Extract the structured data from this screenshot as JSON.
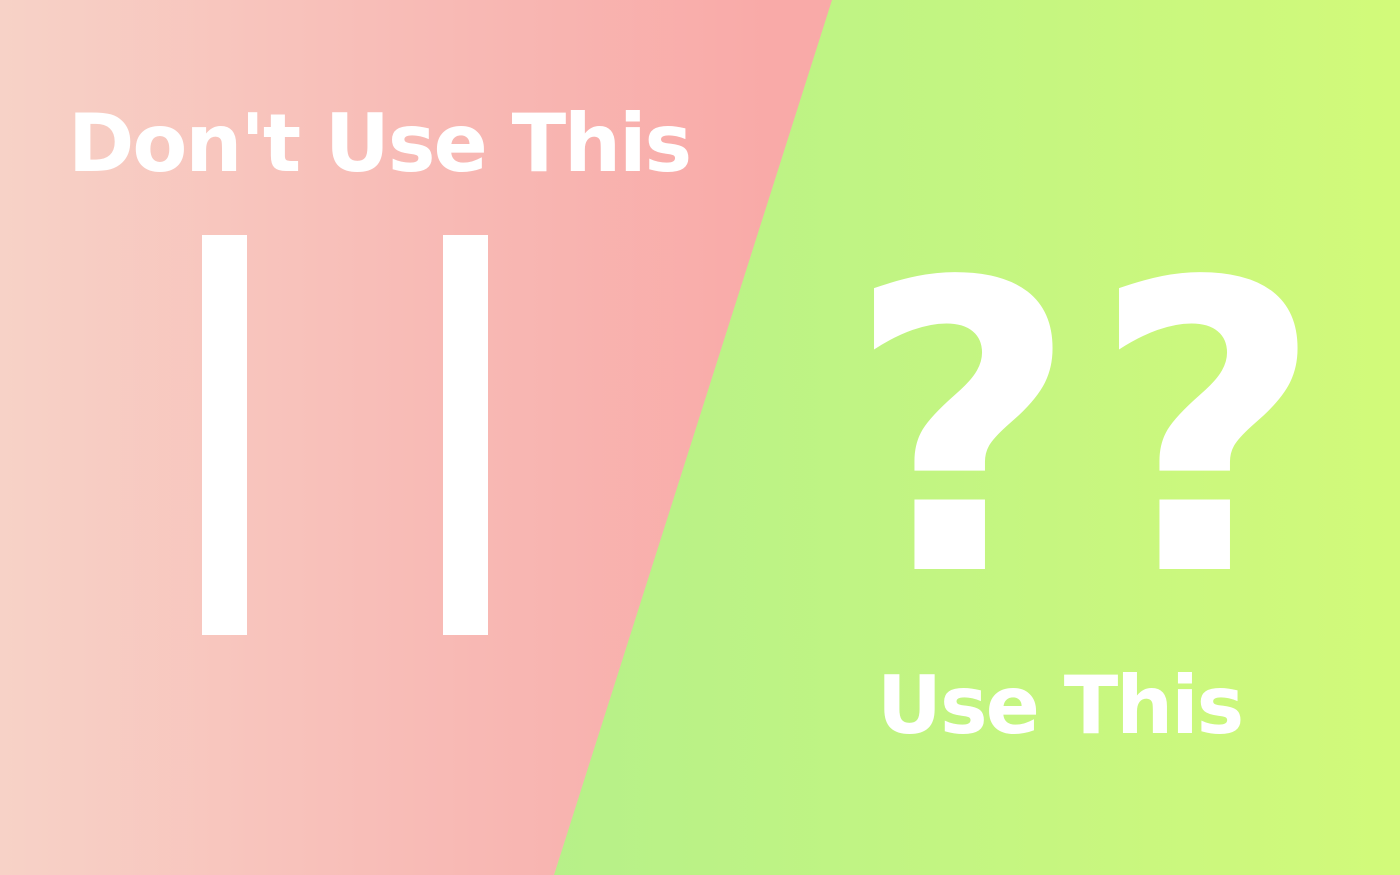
{
  "left_panel": {
    "title": "Don't Use This",
    "symbol": "||",
    "color": "#faa7a7"
  },
  "right_panel": {
    "title": "Use This",
    "symbol": "??",
    "color": "#b8f087"
  }
}
